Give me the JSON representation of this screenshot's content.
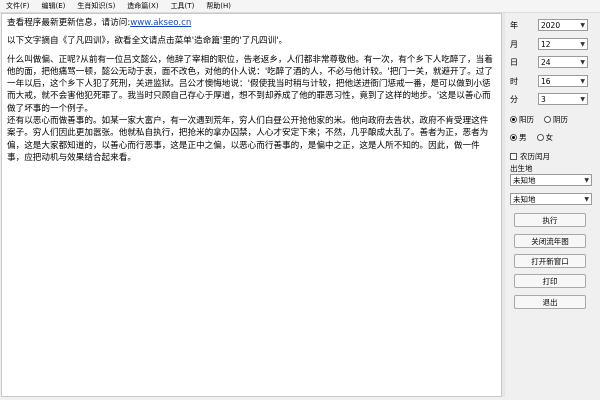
{
  "menu": [
    "文件(F)",
    "编辑(E)",
    "生肖知识(S)",
    "造命篇(X)",
    "工具(T)",
    "帮助(H)"
  ],
  "content": {
    "line1_prefix": "查看程序最新更新信息，请访问:",
    "line1_link": "www.akseo.cn",
    "line2": "以下文字摘自《了凡四训》，欲看全文请点击菜单'造命篇'里的'了凡四训'。",
    "para1": "什么叫做偏、正呢?从前有一位吕文懿公，他辞了宰相的职位，告老返乡，人们都非常尊敬他。有一次，有个乡下人吃醉了，当着他的面，把他痛骂一顿，懿公无动于衷，面不改色，对他的仆人说：'吃醉了酒的人，不必与他计较。'把门一关，就避开了。过了一年以后，这个乡下人犯了死刑，关进监狱。吕公才懊悔地说：'假使我当时稍与计较，把他送进衙门惩戒一番，是可以做到小惩而大戒，就不会害他犯死罪了。我当时只顾自己存心于厚道，想不到却养成了他的罪恶习性，竟到了这样的地步。'这是以善心而做了坏事的一个例子。",
    "para2": "还有以恶心而做善事的。如某一家大富户，有一次遇到荒年，穷人们白昼公开抢他家的米。他向政府去告状，政府不肯受理这件案子。穷人们因此更加嚣张。他就私自执行，把抢米的拿办囚禁，人心才安定下来；不然，几乎酿成大乱了。善者为正，恶者为偏，这是大家都知道的，以善心而行恶事，这是正中之偏，以恶心而行善事的，是偏中之正，这是人所不知的。因此，做一件事，应把动机与效果结合起来看。"
  },
  "panel": {
    "year": {
      "label": "年",
      "value": "2020"
    },
    "month": {
      "label": "月",
      "value": "12"
    },
    "day": {
      "label": "日",
      "value": "24"
    },
    "hour": {
      "label": "时",
      "value": "16"
    },
    "minute": {
      "label": "分",
      "value": "3"
    },
    "calendar": {
      "solar": "阳历",
      "lunar": "阴历",
      "selected": "solar"
    },
    "gender": {
      "male": "男",
      "female": "女",
      "selected": "male"
    },
    "leap_month": "农历闰月",
    "birthplace_label": "出生地",
    "place1": "未知地",
    "place2": "未知地",
    "buttons": {
      "execute": "执行",
      "close_flow": "关闭流年图",
      "open_window": "打开新窗口",
      "print": "打印",
      "exit": "退出"
    }
  }
}
